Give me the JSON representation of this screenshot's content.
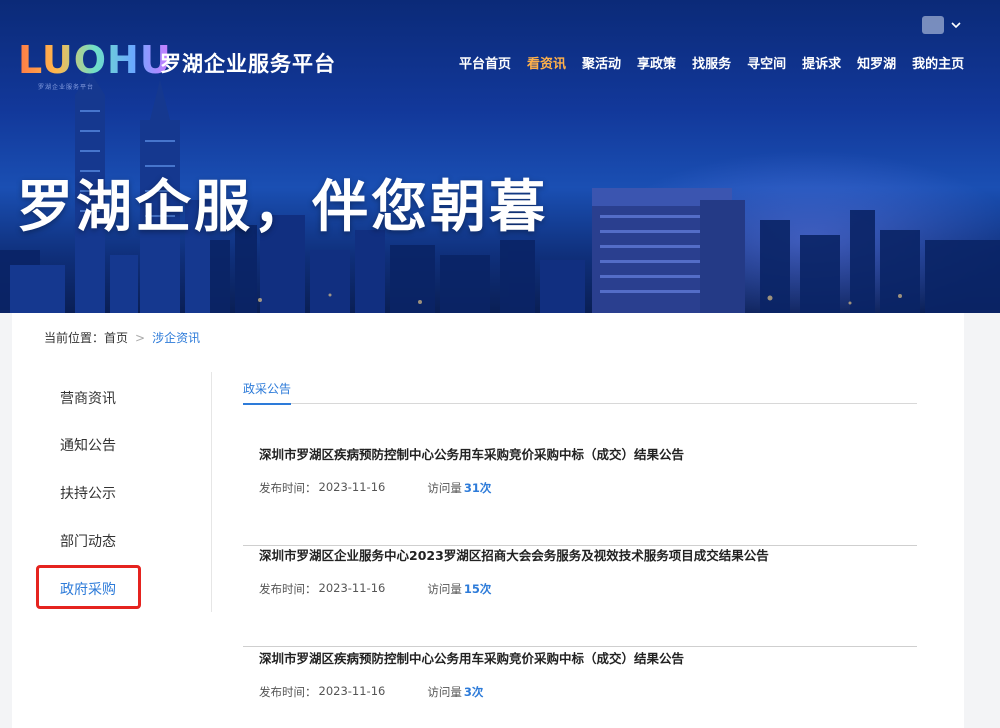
{
  "header": {
    "logo_text": "LUOHU",
    "logo_tagline": "罗湖企业服务平台",
    "site_title": "罗湖企业服务平台",
    "slogan": "罗湖企服，伴您朝暮",
    "nav": [
      {
        "label": "平台首页",
        "active": false
      },
      {
        "label": "看资讯",
        "active": true
      },
      {
        "label": "聚活动",
        "active": false
      },
      {
        "label": "享政策",
        "active": false
      },
      {
        "label": "找服务",
        "active": false
      },
      {
        "label": "寻空间",
        "active": false
      },
      {
        "label": "提诉求",
        "active": false
      },
      {
        "label": "知罗湖",
        "active": false
      },
      {
        "label": "我的主页",
        "active": false
      }
    ]
  },
  "breadcrumb": {
    "prefix": "当前位置：",
    "home": "首页",
    "separator": ">",
    "current": "涉企资讯"
  },
  "sidebar": {
    "items": [
      {
        "label": "营商资讯",
        "active": false
      },
      {
        "label": "通知公告",
        "active": false
      },
      {
        "label": "扶持公示",
        "active": false
      },
      {
        "label": "部门动态",
        "active": false
      },
      {
        "label": "政府采购",
        "active": true
      }
    ]
  },
  "tabs": [
    {
      "label": "政采公告",
      "active": true
    }
  ],
  "articles": [
    {
      "title": "深圳市罗湖区疾病预防控制中心公务用车采购竞价采购中标（成交）结果公告",
      "date_label": "发布时间：",
      "date": "2023-11-16",
      "views_label": "访问量",
      "views": "31次"
    },
    {
      "title": "深圳市罗湖区企业服务中心2023罗湖区招商大会会务服务及视效技术服务项目成交结果公告",
      "date_label": "发布时间：",
      "date": "2023-11-16",
      "views_label": "访问量",
      "views": "15次"
    },
    {
      "title": "深圳市罗湖区疾病预防控制中心公务用车采购竞价采购中标（成交）结果公告",
      "date_label": "发布时间：",
      "date": "2023-11-16",
      "views_label": "访问量",
      "views": "3次"
    }
  ],
  "colors": {
    "accent": "#2d7bd9",
    "nav_active": "#ffb14a",
    "highlight_box": "#e5231f"
  }
}
